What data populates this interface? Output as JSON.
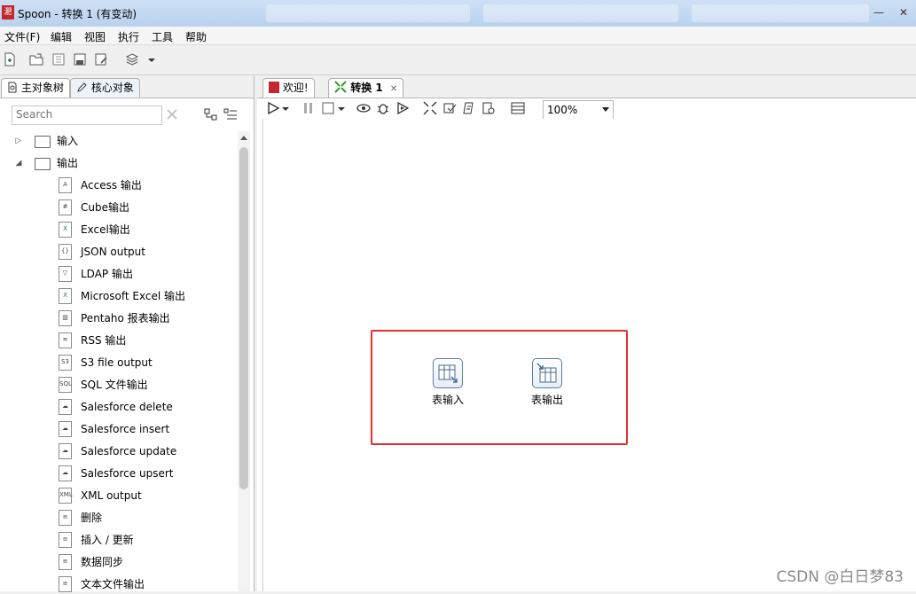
{
  "window": {
    "title": "Spoon - 转换 1 (有变动)",
    "logo_text": "淝",
    "controls": {
      "minimize": "—",
      "close": "✕"
    }
  },
  "menu": [
    "文件(F)",
    "编辑",
    "视图",
    "执行",
    "工具",
    "帮助"
  ],
  "left_panel": {
    "tabs": [
      "主对象树",
      "核心对象"
    ],
    "search": {
      "placeholder": "Search",
      "value": ""
    },
    "tree": [
      {
        "label": "输入",
        "expanded": false,
        "type": "folder"
      },
      {
        "label": "输出",
        "expanded": true,
        "type": "folder",
        "children": [
          {
            "label": "Access 输出",
            "icon": "A"
          },
          {
            "label": "Cube输出",
            "icon": "#"
          },
          {
            "label": "Excel输出",
            "icon": "X"
          },
          {
            "label": "JSON output",
            "icon": "{}"
          },
          {
            "label": "LDAP 输出",
            "icon": "▽"
          },
          {
            "label": "Microsoft Excel 输出",
            "icon": "X"
          },
          {
            "label": "Pentaho 报表输出",
            "icon": "▥"
          },
          {
            "label": "RSS 输出",
            "icon": "≋"
          },
          {
            "label": "S3 file output",
            "icon": "S3"
          },
          {
            "label": "SQL 文件输出",
            "icon": "SQL"
          },
          {
            "label": "Salesforce delete",
            "icon": "☁"
          },
          {
            "label": "Salesforce insert",
            "icon": "☁"
          },
          {
            "label": "Salesforce update",
            "icon": "☁"
          },
          {
            "label": "Salesforce upsert",
            "icon": "☁"
          },
          {
            "label": "XML output",
            "icon": "XML"
          },
          {
            "label": "删除",
            "icon": "≡"
          },
          {
            "label": "插入 / 更新",
            "icon": "≡"
          },
          {
            "label": "数据同步",
            "icon": "≡"
          },
          {
            "label": "文本文件输出",
            "icon": "≡"
          }
        ]
      }
    ]
  },
  "editor": {
    "tabs": [
      {
        "label": "欢迎!",
        "icon": "spoon-logo-icon",
        "active": false
      },
      {
        "label": "转换 1",
        "icon": "transform-icon",
        "active": true,
        "closable": "✕"
      }
    ],
    "zoom": "100%",
    "steps": [
      {
        "label": "表输入"
      },
      {
        "label": "表输出"
      }
    ]
  },
  "watermark": "CSDN @白日梦83",
  "colors": {
    "highlight": "#e03030",
    "logo_red": "#c4262e",
    "transform_green": "#2e9a2e"
  }
}
